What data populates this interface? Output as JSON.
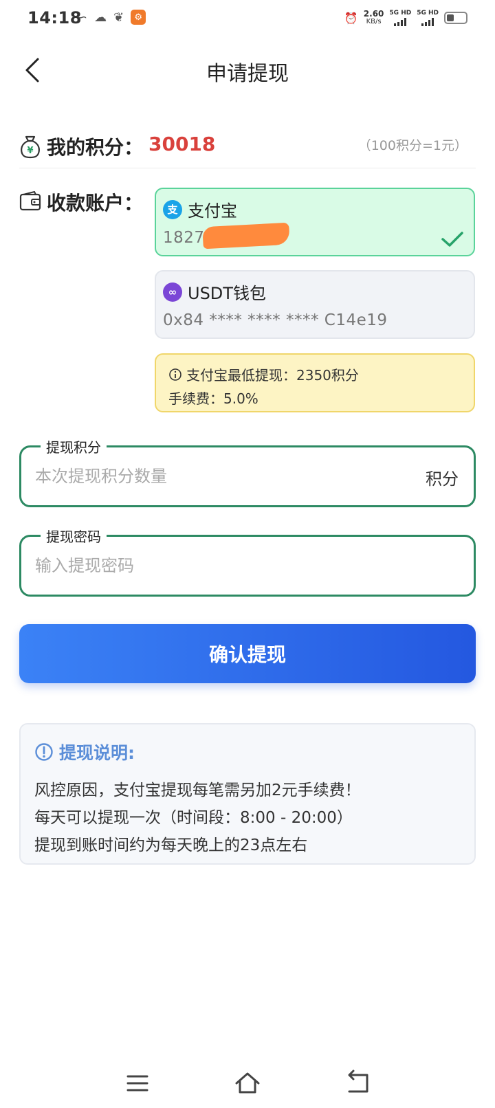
{
  "status_bar": {
    "time": "14:18",
    "net_speed": "2.60",
    "net_speed_unit": "KB/s",
    "signal1": "5G HD",
    "signal2": "5G HD"
  },
  "header": {
    "title": "申请提现"
  },
  "points": {
    "label": "我的积分：",
    "value": "30018",
    "rate": "（100积分=1元）"
  },
  "account": {
    "label": "收款账户：",
    "options": [
      {
        "name": "支付宝",
        "number": "18271",
        "logo_char": "支",
        "selected": true
      },
      {
        "name": "USDT钱包",
        "number": "0x84 **** **** **** C14e19",
        "logo_char": "∞",
        "selected": false
      }
    ]
  },
  "notice": {
    "line1": "支付宝最低提现：2350积分",
    "line2": "手续费：5.0%"
  },
  "form": {
    "points_legend": "提现积分",
    "points_placeholder": "本次提现积分数量",
    "points_unit": "积分",
    "password_legend": "提现密码",
    "password_placeholder": "输入提现密码"
  },
  "confirm_button": "确认提现",
  "instructions": {
    "title": "提现说明:",
    "lines": [
      "风控原因，支付宝提现每笔需另加2元手续费！",
      "每天可以提现一次（时间段：8:00 - 20:00）",
      "提现到账时间约为每天晚上的23点左右"
    ]
  },
  "colors": {
    "accent_blue": "#2f6ef0",
    "points_red": "#d9413c",
    "field_green": "#2d8a63",
    "selected_bg": "#d9fbe6",
    "notice_bg": "#fdf4c4"
  }
}
